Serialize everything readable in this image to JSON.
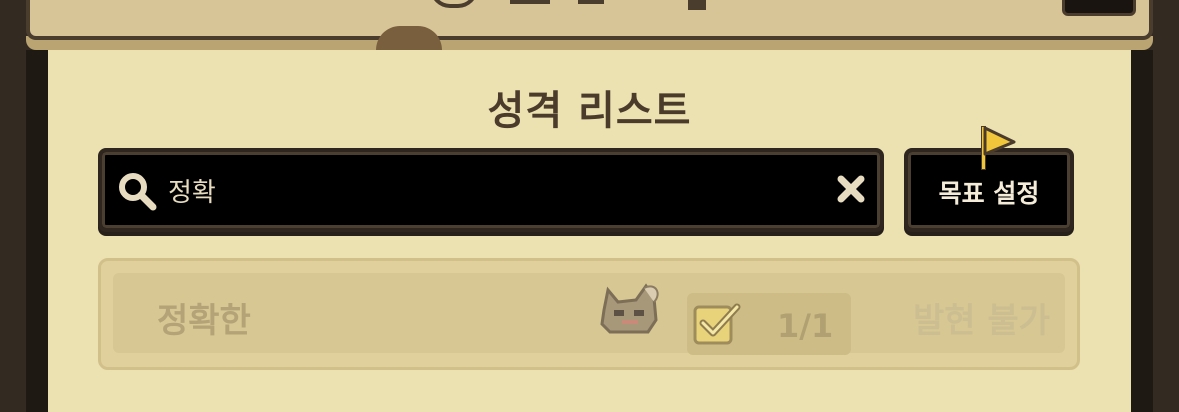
{
  "header": {
    "title": "성격 리스트"
  },
  "search": {
    "value": "정확"
  },
  "goal_button": {
    "label": "목표 설정"
  },
  "traits": [
    {
      "name": "정확한",
      "progress": "1/1",
      "status": "발현 불가"
    }
  ],
  "colors": {
    "panel_bg": "#ebe1b1",
    "frame": "#332a22",
    "text_dark": "#4a3b2b",
    "flag": "#f1c63a",
    "disabled_text": "#b4a377"
  },
  "icons": [
    "search-icon",
    "clear-icon",
    "flag-icon",
    "creature-icon",
    "check-icon"
  ]
}
